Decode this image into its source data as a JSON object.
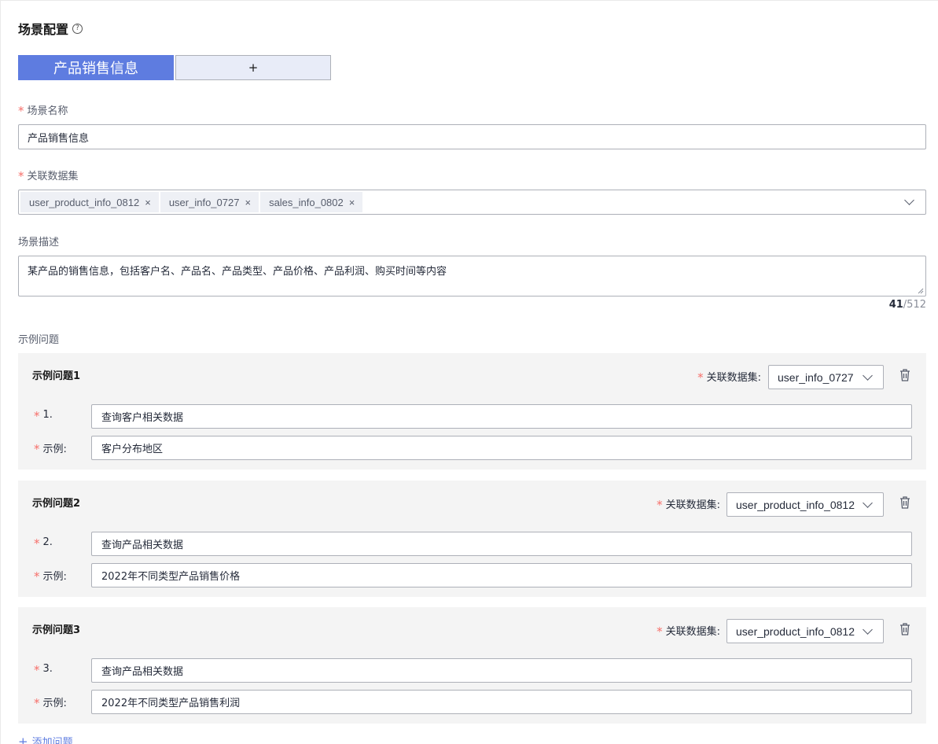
{
  "page": {
    "title": "场景配置",
    "help_icon": "?"
  },
  "tabs": [
    {
      "label": "产品销售信息",
      "active": true
    },
    {
      "label": "+",
      "active": false
    }
  ],
  "form": {
    "scene_name": {
      "label": "场景名称",
      "value": "产品销售信息"
    },
    "datasets": {
      "label": "关联数据集",
      "selected": [
        "user_product_info_0812",
        "user_info_0727",
        "sales_info_0802"
      ],
      "remove_glyph": "×"
    },
    "description": {
      "label": "场景描述",
      "value": "某产品的销售信息，包括客户名、产品名、产品类型、产品价格、产品利润、购买时间等内容",
      "count": "41",
      "max": "/512"
    },
    "examples_label": "示例问题"
  },
  "example_cards": [
    {
      "title": "示例问题1",
      "ds_label": "关联数据集:",
      "dataset": "user_info_0727",
      "num_label": "1.",
      "question": "查询客户相关数据",
      "example_label": "示例:",
      "example": "客户分布地区"
    },
    {
      "title": "示例问题2",
      "ds_label": "关联数据集:",
      "dataset": "user_product_info_0812",
      "num_label": "2.",
      "question": "查询产品相关数据",
      "example_label": "示例:",
      "example": "2022年不同类型产品销售价格"
    },
    {
      "title": "示例问题3",
      "ds_label": "关联数据集:",
      "dataset": "user_product_info_0812",
      "num_label": "3.",
      "question": "查询产品相关数据",
      "example_label": "示例:",
      "example": "2022年不同类型产品销售利润"
    }
  ],
  "add_question": {
    "icon": "+",
    "label": "添加问题"
  },
  "colors": {
    "primary": "#5e7ce0",
    "required": "#f66f6a",
    "card_bg": "#f4f4f4",
    "border": "#adb0b8"
  }
}
